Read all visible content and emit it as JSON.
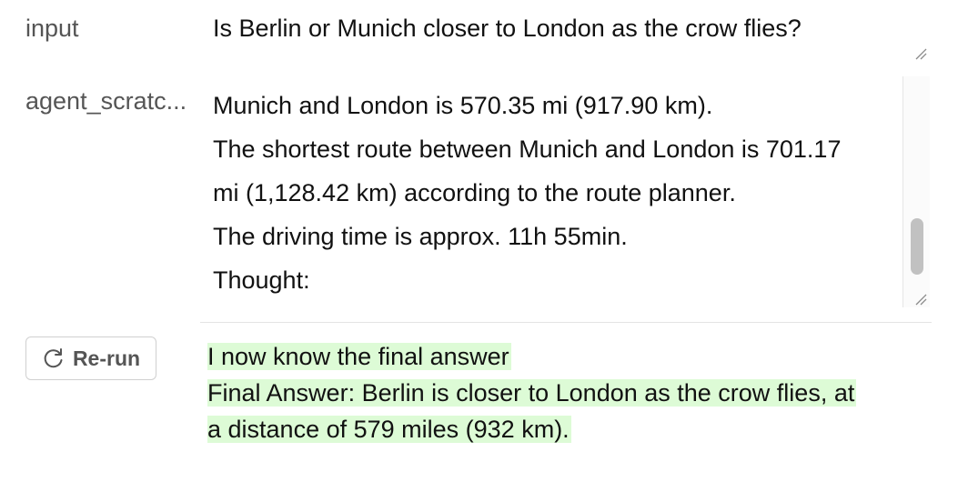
{
  "fields": {
    "input_label": "input",
    "input_value": "Is Berlin or Munich closer to London as the crow flies?",
    "scratchpad_label": "agent_scratc...",
    "scratchpad_lines": [
      "Munich and London is 570.35 mi (917.90 km).",
      "The shortest route between Munich and London is 701.17",
      "mi (1,128.42 km) according to the route planner.",
      "The driving time is approx. 11h 55min.",
      "Thought:"
    ]
  },
  "actions": {
    "rerun_label": "Re-run"
  },
  "output": {
    "answer_lines": [
      "I now know the final answer",
      "Final Answer: Berlin is closer to London as the crow flies, at",
      "a distance of 579 miles (932 km)."
    ]
  },
  "colors": {
    "highlight": "#ddfbd6"
  },
  "icons": {
    "rerun": "refresh-icon",
    "resize": "resize-grip-icon"
  }
}
